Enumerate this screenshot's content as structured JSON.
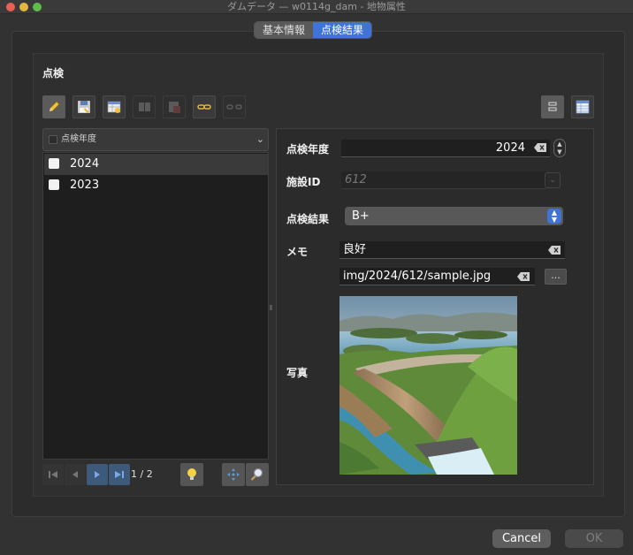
{
  "window": {
    "title": "ダムデータ — w0114g_dam - 地物属性"
  },
  "tabs": [
    {
      "label": "基本情報",
      "active": false
    },
    {
      "label": "点検結果",
      "active": true
    }
  ],
  "group": {
    "title": "点検"
  },
  "list": {
    "header": "点検年度",
    "items": [
      {
        "label": "2024",
        "selected": true
      },
      {
        "label": "2023",
        "selected": false
      }
    ],
    "counter": "1 / 2"
  },
  "form": {
    "year": {
      "label": "点検年度",
      "value": "2024"
    },
    "facility_id": {
      "label": "施設ID",
      "value": "612"
    },
    "result": {
      "label": "点検結果",
      "value": "B+"
    },
    "memo": {
      "label": "メモ",
      "value": "良好"
    },
    "photo_path": {
      "value": "img/2024/612/sample.jpg",
      "browse_label": "..."
    },
    "photo": {
      "label": "写真"
    }
  },
  "buttons": {
    "cancel": "Cancel",
    "ok": "OK"
  },
  "colors": {
    "accent": "#3f73d6",
    "background": "#323232"
  }
}
